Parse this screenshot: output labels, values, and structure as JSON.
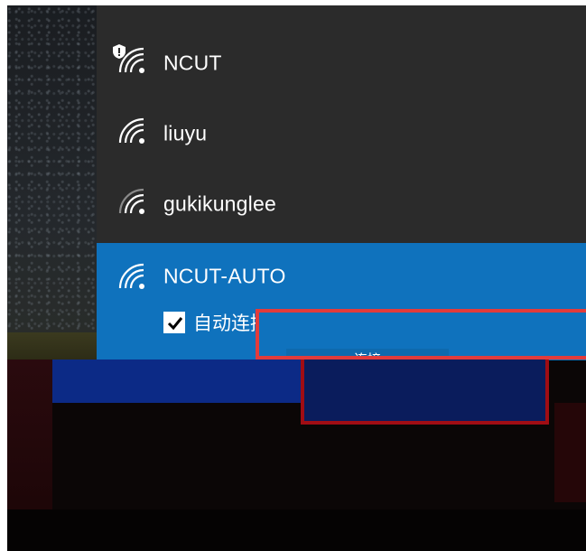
{
  "networks": [
    {
      "name": "NCUT",
      "secured_warning": true
    },
    {
      "name": "liuyu",
      "secured_warning": false
    },
    {
      "name": "gukikunglee",
      "secured_warning": false
    },
    {
      "name": "NCUT-AUTO",
      "secured_warning": false
    }
  ],
  "selected_network": {
    "auto_connect_label": "自动连接",
    "auto_connect_checked": true,
    "connect_label": "连接"
  },
  "colors": {
    "flyout_bg": "#2b2b2b",
    "selected_bg": "#0f72bd",
    "highlight_border": "#e23b3b",
    "text": "#ffffff"
  },
  "icons": {
    "wifi": "wifi-signal-icon",
    "shield": "shield-warning-icon",
    "check": "checkmark-icon"
  }
}
